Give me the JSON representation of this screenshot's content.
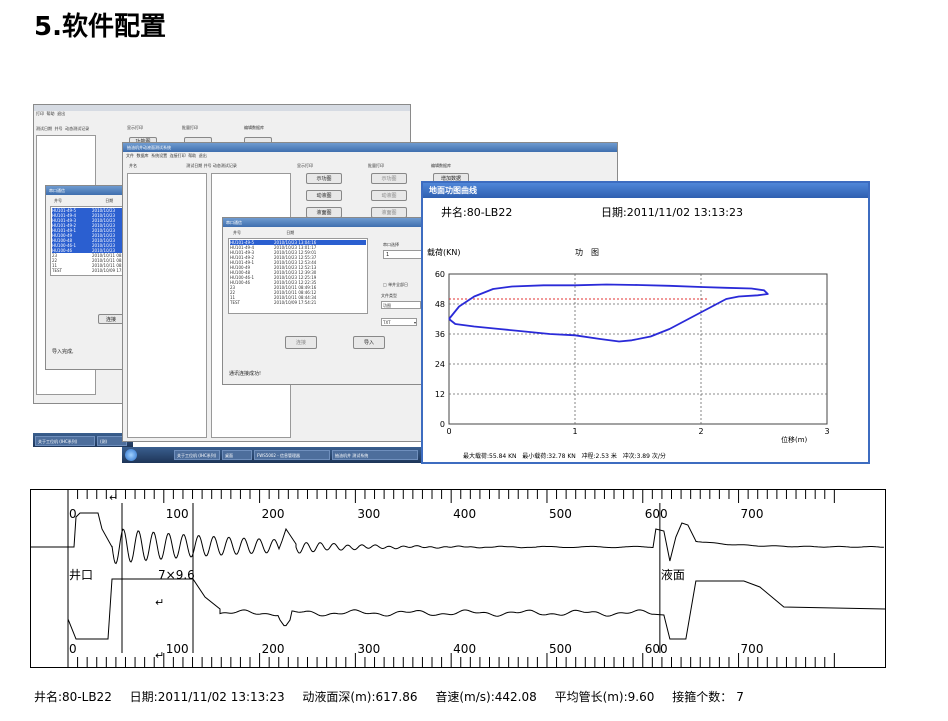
{
  "heading": "5.软件配置",
  "back_window": {
    "menu": [
      "打印",
      "帮助",
      "退出"
    ],
    "cols": [
      "测试日期",
      "井号",
      "动态测试记录"
    ],
    "groups": [
      "显示打印",
      "批量打印",
      "编辑数据库"
    ],
    "buttons": [
      "功能图",
      "",
      ""
    ]
  },
  "port_dialog_back": {
    "title": "串口通信",
    "cols": [
      "井号",
      "日期"
    ],
    "rows": [
      {
        "well": "HU101-49-5",
        "date": "2010/10/23",
        "sel": true
      },
      {
        "well": "HU101-49-4",
        "date": "2010/10/23",
        "sel": true
      },
      {
        "well": "HU101-49-3",
        "date": "2010/10/23",
        "sel": true
      },
      {
        "well": "HU101-49-2",
        "date": "2010/10/23",
        "sel": true
      },
      {
        "well": "HU101-49-1",
        "date": "2010/10/23",
        "sel": true
      },
      {
        "well": "HU100-49",
        "date": "2010/10/23",
        "sel": true
      },
      {
        "well": "HU100-48",
        "date": "2010/10/23",
        "sel": true
      },
      {
        "well": "HU100-46-1",
        "date": "2010/10/23",
        "sel": true
      },
      {
        "well": "HU100-46",
        "date": "2010/10/23",
        "sel": true
      },
      {
        "well": "23",
        "date": "2010/10/11 08:4",
        "sel": false
      },
      {
        "well": "22",
        "date": "2010/10/11 08:4",
        "sel": false
      },
      {
        "well": "11",
        "date": "2010/10/11 08:4",
        "sel": false
      },
      {
        "well": "TEST",
        "date": "2010/10/09 17:5",
        "sel": false
      }
    ],
    "connect_btn": "连接",
    "status": "导入完成,"
  },
  "mid_window": {
    "title": "抽油机井动液面测试系统",
    "menu": [
      "文件",
      "数据库",
      "系统设置",
      "连接打印",
      "帮助",
      "退出"
    ],
    "cols": [
      "井名",
      "测试日期",
      "井号",
      "动态测试记录"
    ],
    "groups": [
      "显示打印",
      "批量打印",
      "编辑数据库"
    ],
    "buttons_left": [
      "示功图",
      "动液图",
      "液面图"
    ],
    "buttons_mid": [
      "示功图",
      "动液图",
      "液面图"
    ],
    "buttons_right": [
      "增加数据"
    ]
  },
  "port_dialog_front": {
    "title": "串口通信",
    "cols": [
      "井号",
      "日期"
    ],
    "rows": [
      {
        "well": "HU101-49-5",
        "date": "2010/10/23 13:04:16",
        "sel": true
      },
      {
        "well": "HU101-49-4",
        "date": "2010/10/23 13:01:17",
        "sel": false
      },
      {
        "well": "HU101-49-3",
        "date": "2010/10/23 12:59:01",
        "sel": false
      },
      {
        "well": "HU101-49-2",
        "date": "2010/10/23 12:55:37",
        "sel": false
      },
      {
        "well": "HU101-49-1",
        "date": "2010/10/23 12:53:44",
        "sel": false
      },
      {
        "well": "HU100-49",
        "date": "2010/10/23 12:52:13",
        "sel": false
      },
      {
        "well": "HU100-48",
        "date": "2010/10/23 12:39:30",
        "sel": false
      },
      {
        "well": "HU100-46-1",
        "date": "2010/10/23 12:25:19",
        "sel": false
      },
      {
        "well": "HU100-46",
        "date": "2010/10/23 12:22:35",
        "sel": false
      },
      {
        "well": "23",
        "date": "2010/10/11 08:49:16",
        "sel": false
      },
      {
        "well": "22",
        "date": "2010/10/11 08:46:12",
        "sel": false
      },
      {
        "well": "11",
        "date": "2010/10/11 08:44:34",
        "sel": false
      },
      {
        "well": "TEST",
        "date": "2010/10/09 17:54:21",
        "sel": false
      }
    ],
    "port_label": "串口选择",
    "port_value": "1",
    "checkbox_label": "单井全部日",
    "file_type_label": "文件类型",
    "file_type_value": "功图",
    "format_value": "TXT",
    "connect_btn": "连接",
    "import_btn": "导入",
    "status": "通讯连接成功!"
  },
  "taskbar_back": {
    "items": [
      "关于工位机 (IHC系列)",
      "(测)"
    ]
  },
  "taskbar_front": {
    "items": [
      "关于工位机 (IHC系列)",
      "桌面",
      "FWS5002 - 信息管理器",
      "抽油机井 测试系统"
    ]
  },
  "dyno_window": {
    "title": "地面功图曲线",
    "well_label": "井名:80-LB22",
    "date_label": "日期:2011/11/02 13:13:23",
    "load_label": "载荷(KN)",
    "chart_label": "功　图",
    "x_axis_label": "位移(m)",
    "stats": [
      "最大载荷:55.84 KN",
      "最小载荷:32.78 KN",
      "冲程:2.53 米",
      "冲次:3.89 次/分"
    ]
  },
  "echo_chart": {
    "top_ticks": [
      "0",
      "100",
      "200",
      "300",
      "400",
      "500",
      "600",
      "700"
    ],
    "bottom_ticks": [
      "0",
      "100",
      "200",
      "300",
      "400",
      "500",
      "600",
      "700"
    ],
    "wellhead_label": "井口",
    "coupling_label": "7×9.6",
    "liquid_label": "液面",
    "return_mark": "↵"
  },
  "footer": {
    "well": "井名:80-LB22",
    "date": "日期:2011/11/02 13:13:23",
    "level": "动液面深(m):617.86",
    "speed": "音速(m/s):442.08",
    "tube": "平均管长(m):9.60",
    "count_label": "接箍个数：",
    "count": "7"
  },
  "chart_data": [
    {
      "type": "line",
      "title": "功　图",
      "xlabel": "位移(m)",
      "ylabel": "载荷(KN)",
      "xlim": [
        0,
        3
      ],
      "ylim": [
        0,
        60
      ],
      "xticks": [
        0,
        1,
        2,
        3
      ],
      "yticks": [
        0,
        12,
        24,
        36,
        48,
        60
      ],
      "grid": true,
      "series": [
        {
          "color": "#2a2ad8",
          "x": [
            0.0,
            0.08,
            0.2,
            0.35,
            0.5,
            0.75,
            1.0,
            1.25,
            1.5,
            1.75,
            2.0,
            2.2,
            2.4,
            2.5,
            2.53,
            2.45,
            2.3,
            2.2,
            2.05,
            1.9,
            1.75,
            1.6,
            1.45,
            1.35,
            1.2,
            1.0,
            0.8,
            0.6,
            0.4,
            0.2,
            0.05,
            0.0
          ],
          "y": [
            42,
            47,
            51,
            54,
            55,
            55.5,
            55.5,
            55.8,
            55.6,
            55.3,
            54.8,
            54.5,
            54.2,
            53.5,
            52,
            51.5,
            51,
            50,
            46,
            42,
            38,
            35,
            33.5,
            33,
            34,
            35.5,
            36,
            37,
            38,
            39,
            40,
            42
          ]
        }
      ],
      "reference_line": {
        "y": 50,
        "color": "#e03030"
      }
    },
    {
      "type": "line",
      "title": "",
      "xlim": [
        0,
        800
      ],
      "xticks": [
        0,
        100,
        200,
        300,
        400,
        500,
        600,
        700
      ],
      "grid": false,
      "series": [
        {
          "note_free": true,
          "color": "#000"
        },
        {
          "color": "#000"
        }
      ],
      "markers": {
        "wellhead_x": 0,
        "coupling_x": 120,
        "liquid_level_x": 617.86
      }
    }
  ]
}
